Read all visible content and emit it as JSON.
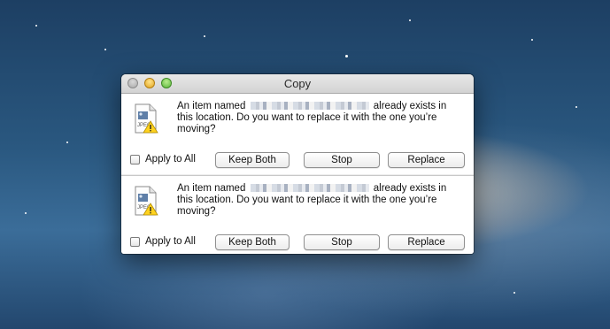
{
  "window": {
    "title": "Copy",
    "traffic_lights": [
      "close",
      "minimize",
      "zoom"
    ]
  },
  "dialogs": [
    {
      "icon": "jpeg-file-warning-icon",
      "message_before": "An item named",
      "message_after": "already exists in this location. Do you want to replace it with the one you’re moving?",
      "apply_to_all_label": "Apply to All",
      "apply_to_all_checked": false,
      "buttons": {
        "keep_both": "Keep Both",
        "stop": "Stop",
        "replace": "Replace"
      }
    },
    {
      "icon": "jpeg-file-warning-icon",
      "message_before": "An item named",
      "message_after": "already exists in this location. Do you want to replace it with the one you’re moving?",
      "apply_to_all_label": "Apply to All",
      "apply_to_all_checked": false,
      "buttons": {
        "keep_both": "Keep Both",
        "stop": "Stop",
        "replace": "Replace"
      }
    }
  ]
}
